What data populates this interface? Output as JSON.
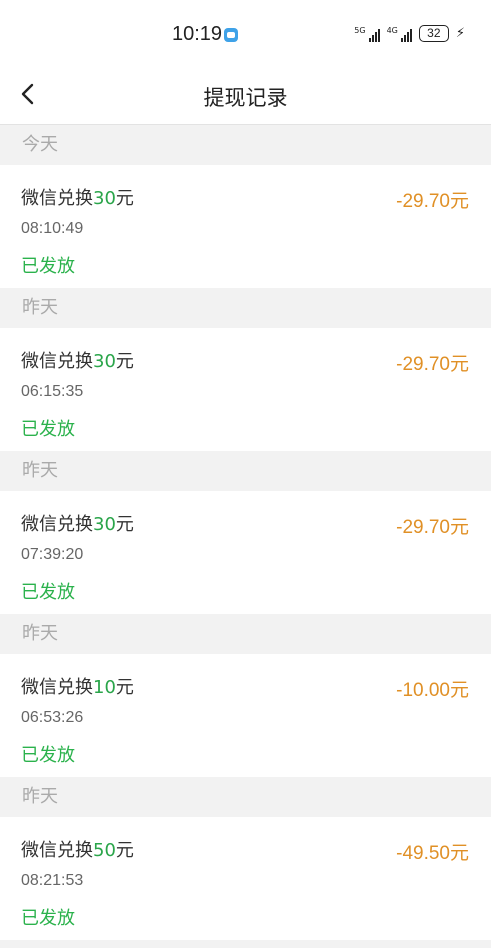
{
  "status_bar": {
    "time": "10:19",
    "network1": "5G",
    "network2": "4G",
    "battery": "32"
  },
  "nav": {
    "title": "提现记录"
  },
  "sections": [
    {
      "header": "今天",
      "record": {
        "prefix": "微信兑换",
        "amount_num": "30",
        "suffix": "元",
        "time": "08:10:49",
        "status": "已发放",
        "change": "-29.70元"
      }
    },
    {
      "header": "昨天",
      "record": {
        "prefix": "微信兑换",
        "amount_num": "30",
        "suffix": "元",
        "time": "06:15:35",
        "status": "已发放",
        "change": "-29.70元"
      }
    },
    {
      "header": "昨天",
      "record": {
        "prefix": "微信兑换",
        "amount_num": "30",
        "suffix": "元",
        "time": "07:39:20",
        "status": "已发放",
        "change": "-29.70元"
      }
    },
    {
      "header": "昨天",
      "record": {
        "prefix": "微信兑换",
        "amount_num": "10",
        "suffix": "元",
        "time": "06:53:26",
        "status": "已发放",
        "change": "-10.00元"
      }
    },
    {
      "header": "昨天",
      "record": {
        "prefix": "微信兑换",
        "amount_num": "50",
        "suffix": "元",
        "time": "08:21:53",
        "status": "已发放",
        "change": "-49.50元"
      }
    }
  ],
  "colors": {
    "accent_green": "#2bb24c",
    "amount_orange": "#e09026",
    "section_bg": "#f2f2f2"
  }
}
